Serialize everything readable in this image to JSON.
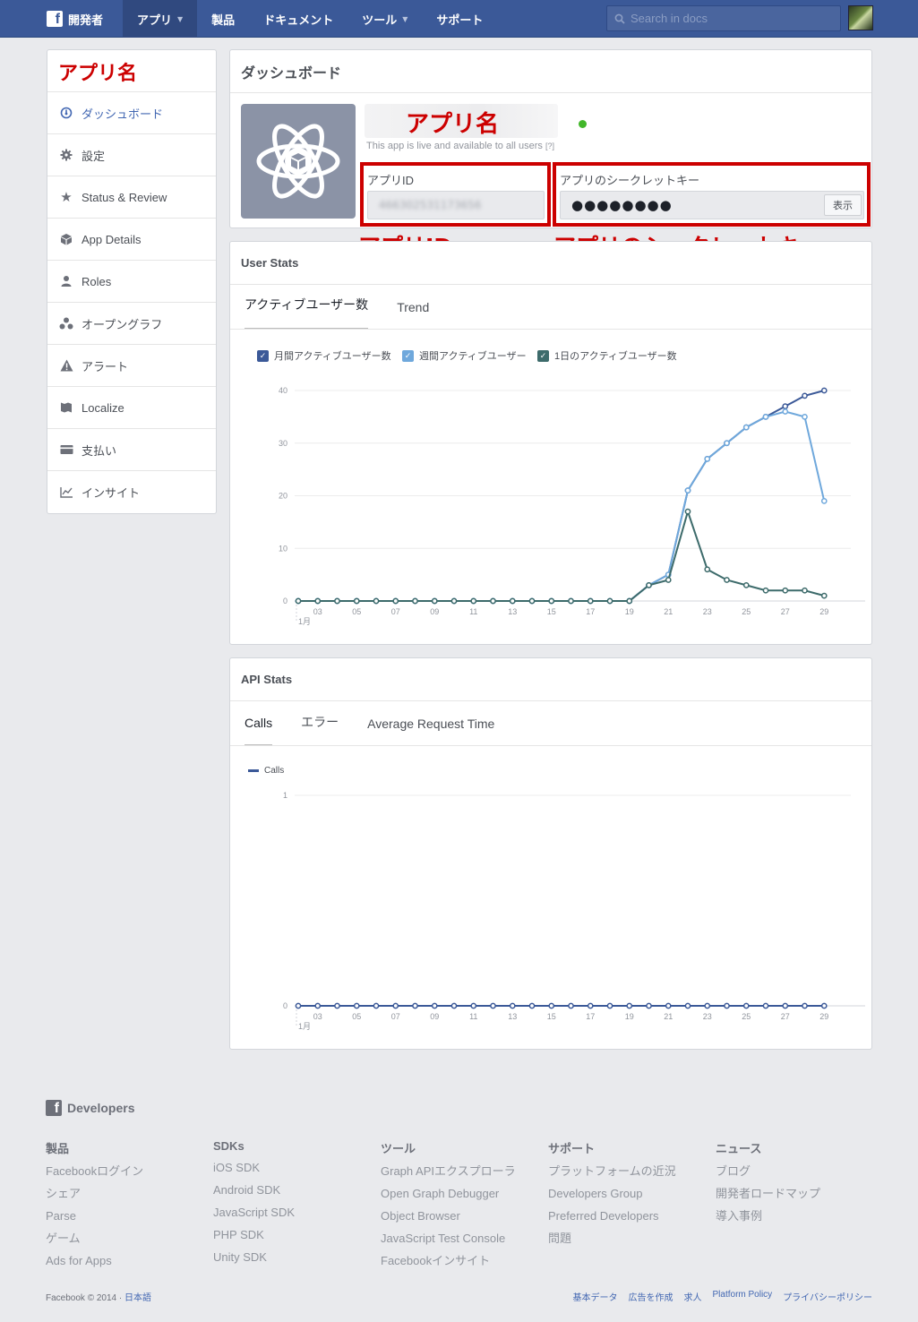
{
  "topbar": {
    "brand": "開発者",
    "nav": [
      "アプリ",
      "製品",
      "ドキュメント",
      "ツール",
      "サポート"
    ],
    "search_placeholder": "Search in docs"
  },
  "sidebar": {
    "app_title": "アプリ名",
    "items": [
      {
        "label": "ダッシュボード",
        "icon": "dashboard-icon"
      },
      {
        "label": "設定",
        "icon": "gear-icon"
      },
      {
        "label": "Status & Review",
        "icon": "star-icon"
      },
      {
        "label": "App Details",
        "icon": "cube-icon"
      },
      {
        "label": "Roles",
        "icon": "person-icon"
      },
      {
        "label": "オープングラフ",
        "icon": "graph-nodes-icon"
      },
      {
        "label": "アラート",
        "icon": "warning-icon"
      },
      {
        "label": "Localize",
        "icon": "flag-icon"
      },
      {
        "label": "支払い",
        "icon": "credit-card-icon"
      },
      {
        "label": "インサイト",
        "icon": "chart-icon"
      }
    ]
  },
  "dashboard": {
    "title": "ダッシュボード",
    "app_name_label": "アプリ名",
    "live_text": "This app is live and available to all users",
    "live_help": "[?]",
    "app_id_label": "アプリID",
    "app_id_value": "466302531173656",
    "secret_label": "アプリのシークレットキー",
    "secret_value": "●●●●●●●●",
    "show_button": "表示",
    "callout_app_id": "アプリID",
    "callout_secret": "アプリのシークレットキー"
  },
  "user_stats": {
    "title": "User Stats",
    "tabs": [
      "アクティブユーザー数",
      "Trend"
    ],
    "legend": [
      "月間アクティブユーザー数",
      "週間アクティブユーザー",
      "1日のアクティブユーザー数"
    ]
  },
  "api_stats": {
    "title": "API Stats",
    "tabs": [
      "Calls",
      "エラー",
      "Average Request Time"
    ],
    "legend": [
      "Calls"
    ]
  },
  "chart_data": [
    {
      "type": "line",
      "x_tick_labels": [
        "03",
        "05",
        "07",
        "09",
        "11",
        "13",
        "15",
        "17",
        "19",
        "21",
        "23",
        "25",
        "27",
        "29"
      ],
      "x_month_label": "1月",
      "x": [
        2,
        3,
        4,
        5,
        6,
        7,
        8,
        9,
        10,
        11,
        12,
        13,
        14,
        15,
        16,
        17,
        18,
        19,
        20,
        21,
        22,
        23,
        24,
        25,
        26,
        27,
        28,
        29,
        30
      ],
      "ylim": [
        0,
        40
      ],
      "y_ticks": [
        0,
        10,
        20,
        30,
        40
      ],
      "series": [
        {
          "name": "月間アクティブユーザー数",
          "color": "#3b5998",
          "values": [
            0,
            0,
            0,
            0,
            0,
            0,
            0,
            0,
            0,
            0,
            0,
            0,
            0,
            0,
            0,
            0,
            0,
            0,
            3,
            5,
            21,
            27,
            30,
            33,
            35,
            37,
            39,
            40,
            null
          ]
        },
        {
          "name": "週間アクティブユーザー",
          "color": "#6fa8dc",
          "values": [
            0,
            0,
            0,
            0,
            0,
            0,
            0,
            0,
            0,
            0,
            0,
            0,
            0,
            0,
            0,
            0,
            0,
            0,
            3,
            5,
            21,
            27,
            30,
            33,
            35,
            36,
            35,
            19,
            null
          ]
        },
        {
          "name": "1日のアクティブユーザー数",
          "color": "#3d6b6b",
          "values": [
            0,
            0,
            0,
            0,
            0,
            0,
            0,
            0,
            0,
            0,
            0,
            0,
            0,
            0,
            0,
            0,
            0,
            0,
            3,
            4,
            17,
            6,
            4,
            3,
            2,
            2,
            2,
            1,
            null
          ]
        }
      ]
    },
    {
      "type": "line",
      "x_tick_labels": [
        "03",
        "05",
        "07",
        "09",
        "11",
        "13",
        "15",
        "17",
        "19",
        "21",
        "23",
        "25",
        "27",
        "29"
      ],
      "x_month_label": "1月",
      "x": [
        2,
        3,
        4,
        5,
        6,
        7,
        8,
        9,
        10,
        11,
        12,
        13,
        14,
        15,
        16,
        17,
        18,
        19,
        20,
        21,
        22,
        23,
        24,
        25,
        26,
        27,
        28,
        29,
        30
      ],
      "ylim": [
        0,
        1
      ],
      "y_ticks": [
        0,
        1
      ],
      "series": [
        {
          "name": "Calls",
          "color": "#3b5998",
          "values": [
            0,
            0,
            0,
            0,
            0,
            0,
            0,
            0,
            0,
            0,
            0,
            0,
            0,
            0,
            0,
            0,
            0,
            0,
            0,
            0,
            0,
            0,
            0,
            0,
            0,
            0,
            0,
            0,
            null
          ]
        }
      ]
    }
  ],
  "footer": {
    "brand": "Developers",
    "columns": [
      {
        "title": "製品",
        "links": [
          "Facebookログイン",
          "シェア",
          "Parse",
          "ゲーム",
          "Ads for Apps"
        ]
      },
      {
        "title": "SDKs",
        "links": [
          "iOS SDK",
          "Android SDK",
          "JavaScript SDK",
          "PHP SDK",
          "Unity SDK"
        ]
      },
      {
        "title": "ツール",
        "links": [
          "Graph APIエクスプローラ",
          "Open Graph Debugger",
          "Object Browser",
          "JavaScript Test Console",
          "Facebookインサイト"
        ]
      },
      {
        "title": "サポート",
        "links": [
          "プラットフォームの近況",
          "Developers Group",
          "Preferred Developers",
          "問題"
        ]
      },
      {
        "title": "ニュース",
        "links": [
          "ブログ",
          "開発者ロードマップ",
          "導入事例"
        ]
      }
    ],
    "copyright": "Facebook © 2014 ·",
    "language": "日本語",
    "bottom_links": [
      "基本データ",
      "広告を作成",
      "求人",
      "Platform Policy",
      "プライバシーポリシー"
    ]
  }
}
